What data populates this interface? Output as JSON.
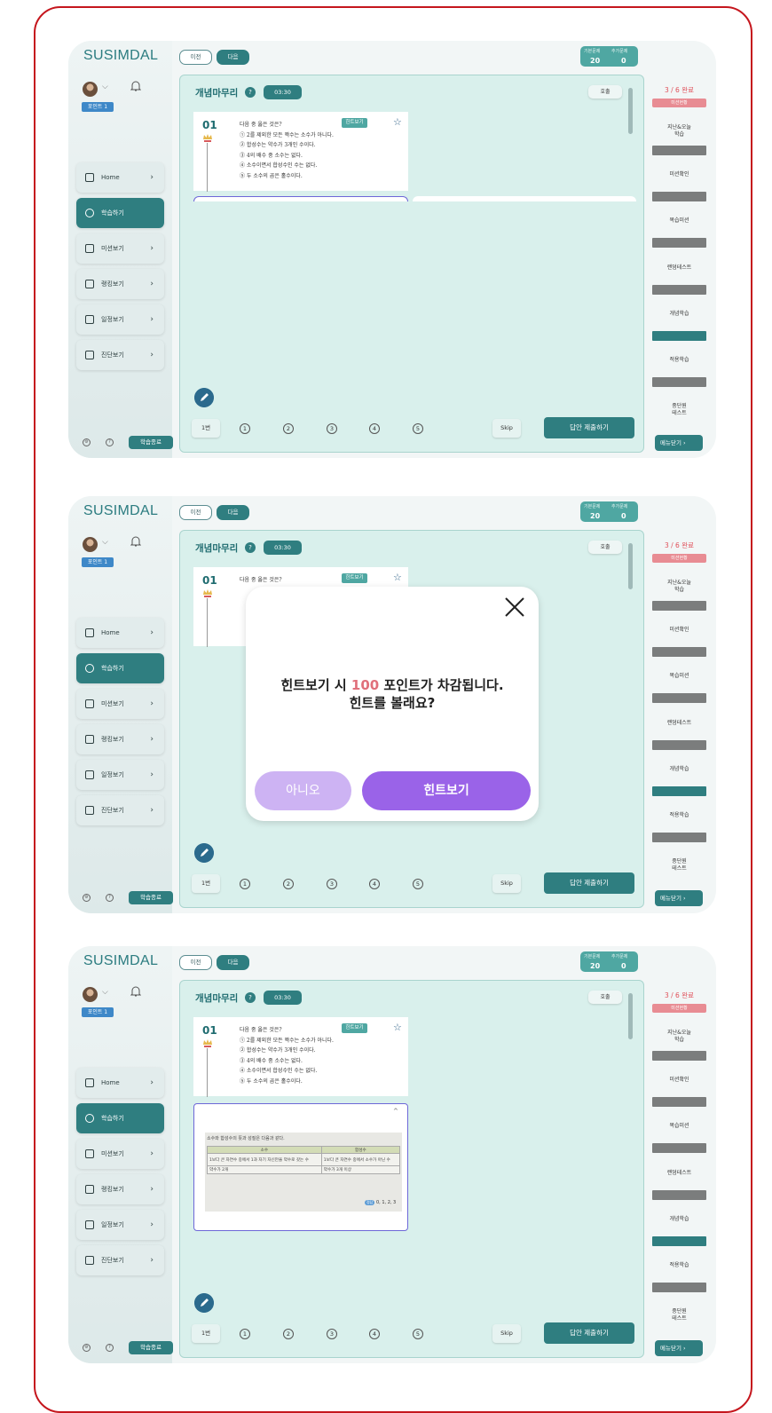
{
  "app": {
    "logo": "SUSIMDAL"
  },
  "user": {
    "badge": "포인트 1"
  },
  "topbar": {
    "prev_label": "이전",
    "next_label": "다음",
    "basic_label": "기본문제",
    "extra_label": "추가문제",
    "basic_count": "20",
    "extra_count": "0"
  },
  "nav": [
    {
      "label": "Home",
      "icon": "home-icon"
    },
    {
      "label": "학습하기",
      "icon": "clock-icon"
    },
    {
      "label": "미션보기",
      "icon": "briefcase-icon"
    },
    {
      "label": "랭킹보기",
      "icon": "chart-icon"
    },
    {
      "label": "일정보기",
      "icon": "calendar-icon"
    },
    {
      "label": "진단보기",
      "icon": "clipboard-icon"
    }
  ],
  "footer": {
    "end_label": "학습종료"
  },
  "panel": {
    "title": "개념마무리",
    "help": "?",
    "timer": "03:30",
    "call_label": "호출"
  },
  "question": {
    "number": "01",
    "stem": "다음 중 옳은 것은?",
    "options": [
      "① 2를 제외한 모든 짝수는 소수가 아니다.",
      "② 합성수는 약수가 3개인 수이다.",
      "③ 4의 배수 중 소수는 없다.",
      "④ 소수이면서 합성수인 수는 없다.",
      "⑤ 두 소수의 곱은 홀수이다."
    ],
    "hint_label": "힌트보기"
  },
  "answer_bar": {
    "page_label": "1번",
    "choices": [
      "1",
      "2",
      "3",
      "4",
      "5"
    ],
    "skip_label": "Skip",
    "submit_label": "답안 제출하기"
  },
  "rightbar": {
    "progress": "3 / 6 완료",
    "progress_tag": "미션현황",
    "items": [
      "지난&오늘\n학습",
      "미션확인",
      "복습미션",
      "랜덤테스트",
      "개념학습",
      "적용학습",
      "중단원\n테스트"
    ],
    "active_index": 4,
    "menu_label": "메뉴닫기"
  },
  "modal": {
    "text_before": "힌트보기 시 ",
    "points": "100",
    "text_after": " 포인트가 차감됩니다.",
    "line2": "힌트를 볼래요?",
    "no_label": "아니오",
    "yes_label": "힌트보기"
  },
  "hint": {
    "title": "소수와 합성수의 뜻과 성질은 다음과 같다.",
    "col1": "소수",
    "col2": "합성수",
    "row1_c1": "1보다 큰 자연수 중에서 1과 자기 자신만을 약수로 갖는 수",
    "row1_c2": "1보다 큰 자연수 중에서 소수가 아닌 수",
    "row2_c1": "약수가 2개",
    "row2_c2": "약수가 3개 이상",
    "answer_tag": "정답",
    "answer": "0, 1, 2, 3"
  },
  "colors": {
    "brand": "#2f7e80",
    "accent_red": "#e0505a",
    "modal_purple": "#9a63e8",
    "modal_light_purple": "#cdb3f3"
  }
}
